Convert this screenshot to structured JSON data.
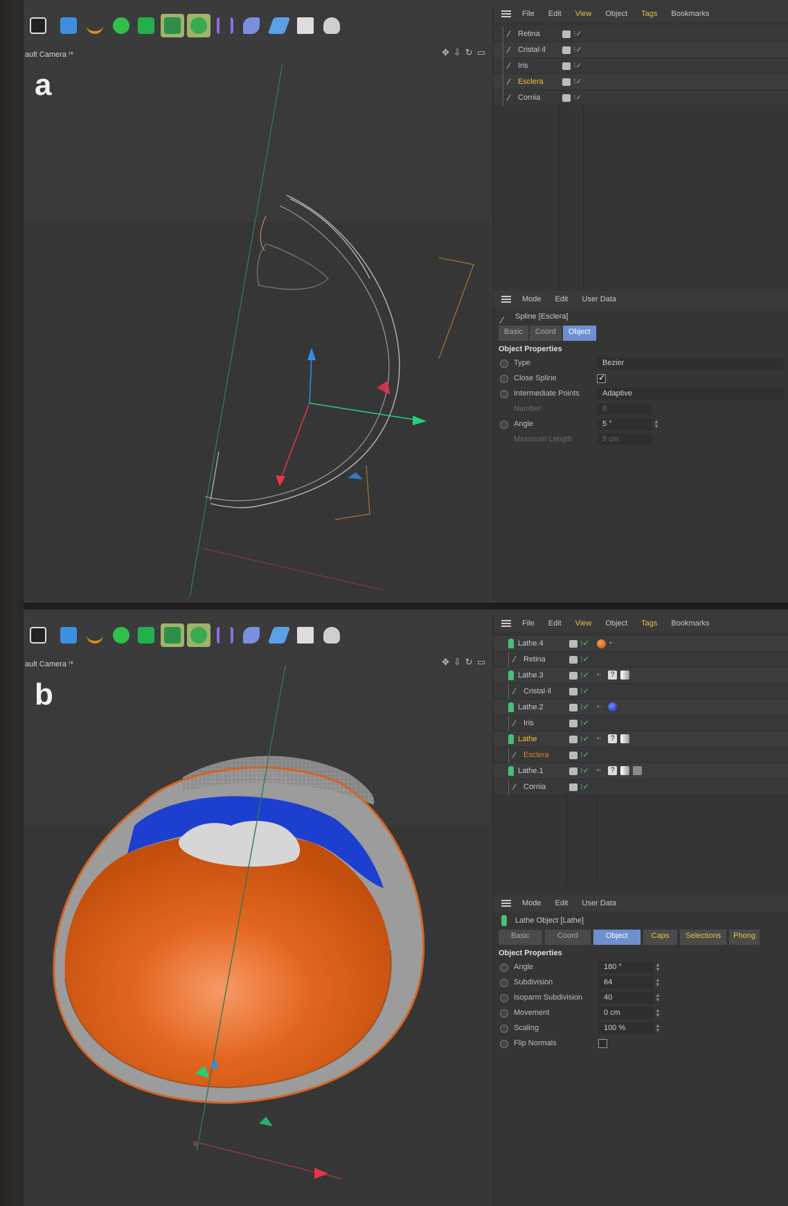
{
  "toolbar_icons": [
    "clapper-icon",
    "cube-icon",
    "pen-icon",
    "green-sphere-icon",
    "green-gear-icon",
    "green-flower-icon",
    "green-clover-icon",
    "deformer-icon",
    "bend-icon",
    "floor-icon",
    "camera-icon",
    "light-icon"
  ],
  "panel_a": {
    "letter": "a",
    "camera_label": "ault Camera ⁽*",
    "menu": [
      "File",
      "Edit",
      "View",
      "Object",
      "Tags",
      "Bookmarks"
    ],
    "objects": [
      {
        "name": "Retina",
        "selected": false
      },
      {
        "name": "Cristal·il",
        "selected": false
      },
      {
        "name": "Iris",
        "selected": false
      },
      {
        "name": "Esclera",
        "selected": true
      },
      {
        "name": "Cornia",
        "selected": false
      }
    ],
    "attr_menu": [
      "Mode",
      "Edit",
      "User Data"
    ],
    "attr_title": "Spline [Esclera]",
    "tabs": [
      {
        "label": "Basic",
        "on": false
      },
      {
        "label": "Coord",
        "on": false
      },
      {
        "label": "Object",
        "on": true
      }
    ],
    "section": "Object Properties",
    "props": [
      {
        "label": "Type",
        "value": "Bezier",
        "kind": "wide"
      },
      {
        "label": "Close Spline",
        "value": "",
        "kind": "check",
        "checked": true
      },
      {
        "label": "Intermediate Points",
        "value": "Adaptive",
        "kind": "wide"
      },
      {
        "label": "Number",
        "value": "8",
        "kind": "num",
        "disabled": true
      },
      {
        "label": "Angle",
        "value": "5 °",
        "kind": "num"
      },
      {
        "label": "Maximum Length",
        "value": "5 cm",
        "kind": "num",
        "disabled": true
      }
    ]
  },
  "panel_b": {
    "letter": "b",
    "camera_label": "ault Camera ⁽*",
    "menu": [
      "File",
      "Edit",
      "View",
      "Object",
      "Tags",
      "Bookmarks"
    ],
    "objects": [
      {
        "name": "Lathe.4",
        "lathe": true,
        "selected": false,
        "tags": [
          "orange-sphere",
          "dots"
        ]
      },
      {
        "name": "Retina",
        "lathe": false,
        "selected": false,
        "tags": []
      },
      {
        "name": "Lathe.3",
        "lathe": true,
        "selected": false,
        "tags": [
          "dots",
          "q",
          "white"
        ]
      },
      {
        "name": "Cristal·il",
        "lathe": false,
        "selected": false,
        "tags": []
      },
      {
        "name": "Lathe.2",
        "lathe": true,
        "selected": false,
        "tags": [
          "dots",
          "blue-sphere"
        ]
      },
      {
        "name": "Iris",
        "lathe": false,
        "selected": false,
        "tags": []
      },
      {
        "name": "Lathe",
        "lathe": true,
        "selected": true,
        "tags": [
          "dots",
          "q",
          "white"
        ]
      },
      {
        "name": "Esclera",
        "lathe": false,
        "selected": true,
        "tags": []
      },
      {
        "name": "Lathe.1",
        "lathe": true,
        "selected": false,
        "tags": [
          "dots",
          "q",
          "white",
          "grey"
        ]
      },
      {
        "name": "Cornia",
        "lathe": false,
        "selected": false,
        "tags": []
      }
    ],
    "attr_menu": [
      "Mode",
      "Edit",
      "User Data"
    ],
    "attr_title": "Lathe Object [Lathe]",
    "tabs": [
      {
        "label": "Basic",
        "on": false
      },
      {
        "label": "Coord",
        "on": false
      },
      {
        "label": "Object",
        "on": true
      },
      {
        "label": "Caps",
        "on": false
      },
      {
        "label": "Selections",
        "on": false
      },
      {
        "label": "Phong",
        "on": false
      }
    ],
    "section": "Object Properties",
    "props": [
      {
        "label": "Angle",
        "value": "180 °",
        "kind": "num"
      },
      {
        "label": "Subdivision",
        "value": "64",
        "kind": "num"
      },
      {
        "label": "Isoparm Subdivision",
        "value": "40",
        "kind": "num"
      },
      {
        "label": "Movement",
        "value": "0 cm",
        "kind": "num"
      },
      {
        "label": "Scaling",
        "value": "100 %",
        "kind": "num"
      },
      {
        "label": "Flip Normals",
        "value": "",
        "kind": "check",
        "checked": false
      }
    ]
  },
  "colors": {
    "accent_blue": "#6f8fd0",
    "selected_yellow": "#f0c040",
    "sphere_orange": "#d95b14",
    "iris_blue": "#1d3fd0",
    "axis_green": "#22d07a",
    "axis_red": "#e8344d",
    "axis_blue": "#2f8fe8"
  }
}
